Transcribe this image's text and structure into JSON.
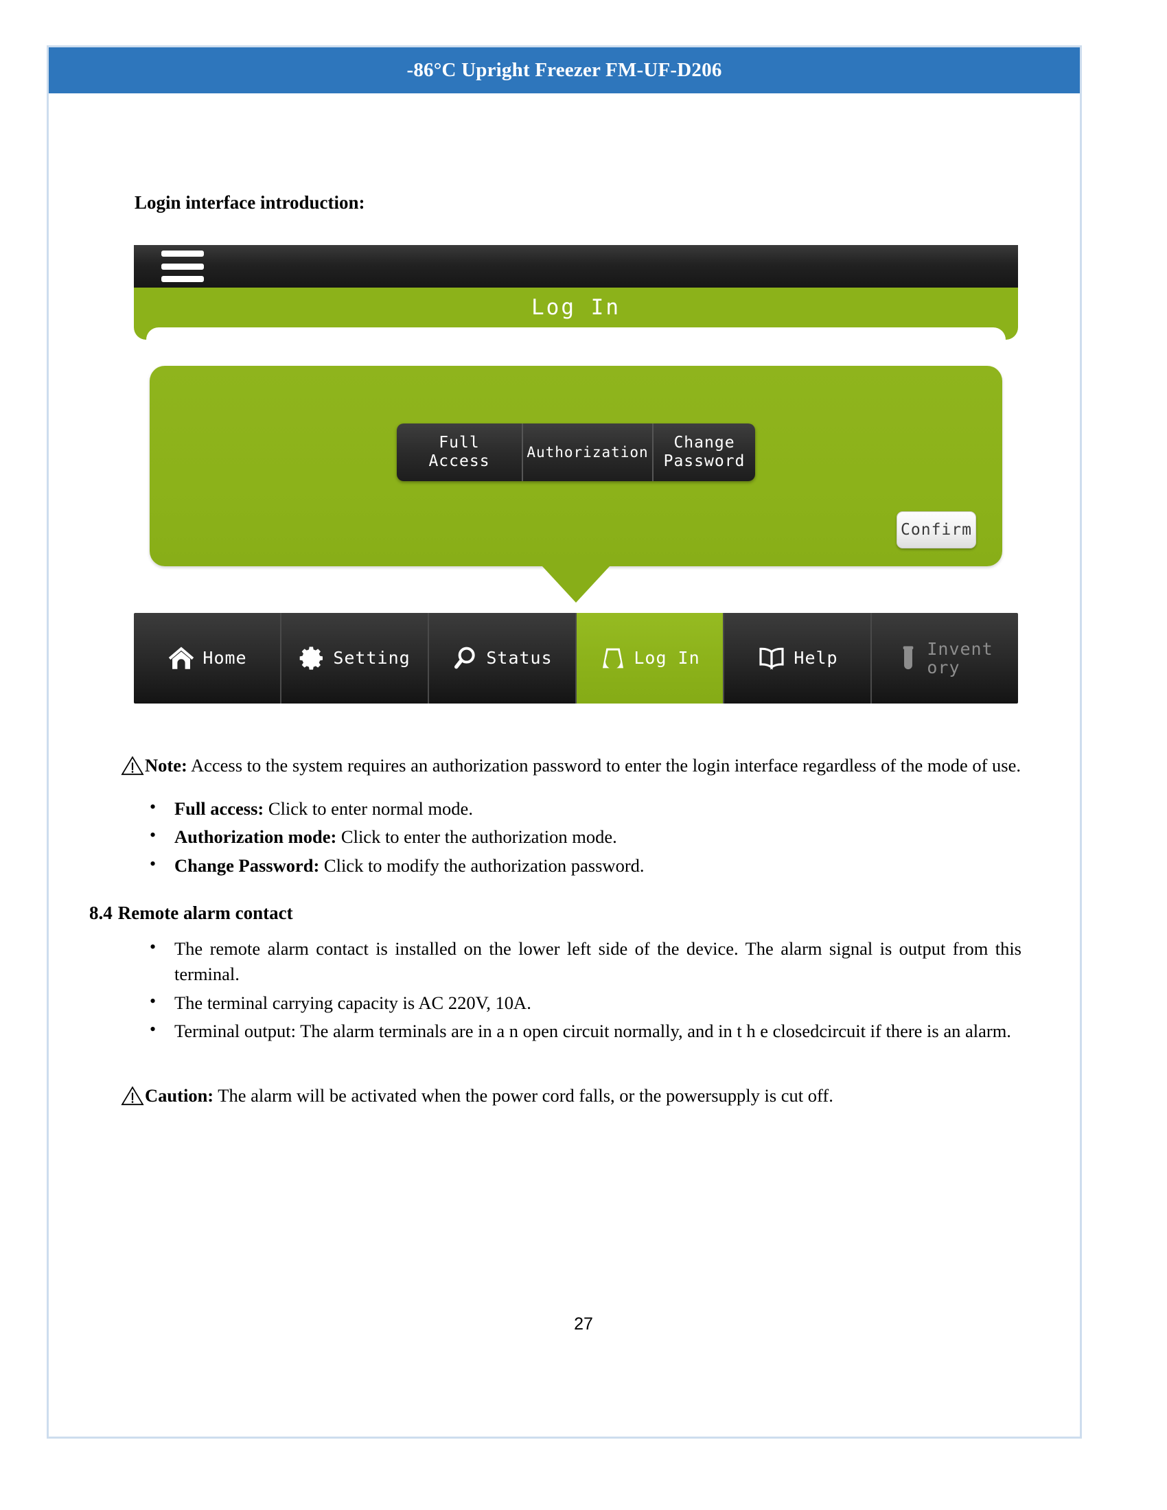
{
  "header": {
    "title": "-86°C Upright Freezer FM-UF-D206"
  },
  "content": {
    "intro_heading": "Login interface introduction:"
  },
  "device": {
    "menu_icon": "hamburger-icon",
    "screen_title": "Log In",
    "mode_buttons": [
      {
        "label": "Full Access",
        "name": "full-access"
      },
      {
        "label": "Authorization",
        "name": "authorization"
      },
      {
        "label": "Change\nPassword",
        "name": "change-password"
      }
    ],
    "confirm_label": "Confirm",
    "nav_items": [
      {
        "label": "Home",
        "icon": "home-icon",
        "active": false,
        "disabled": false
      },
      {
        "label": "Setting",
        "icon": "gear-icon",
        "active": false,
        "disabled": false
      },
      {
        "label": "Status",
        "icon": "magnifier-icon",
        "active": false,
        "disabled": false
      },
      {
        "label": "Log In",
        "icon": "inbox-icon",
        "active": true,
        "disabled": false
      },
      {
        "label": "Help",
        "icon": "book-icon",
        "active": false,
        "disabled": false
      },
      {
        "label": "Invent\nory",
        "icon": "test-tube-icon",
        "active": false,
        "disabled": true
      }
    ]
  },
  "note": {
    "icon": "warning-triangle-icon",
    "label": "Note:",
    "text": " Access to the system requires an authorization password to enter the login interface regardless of the mode of use."
  },
  "mode_list": [
    {
      "label": "Full access:",
      "text": " Click to enter normal mode."
    },
    {
      "label": "Authorization mode:",
      "text": " Click to enter the authorization mode."
    },
    {
      "label": "Change Password:",
      "text": " Click to modify the authorization password."
    }
  ],
  "section_84": {
    "number": "8.4",
    "title": "Remote alarm contact",
    "bullets": [
      "The remote alarm contact is installed on the lower left side of the device. The alarm signal is output from this terminal.",
      "The terminal carrying capacity is AC 220V, 10A.",
      "Terminal output: The alarm terminals are in a n  open circuit normally, and in t h e closedcircuit if there is an alarm."
    ]
  },
  "caution": {
    "icon": "warning-triangle-icon",
    "label": "Caution:",
    "text": " The alarm will be activated when the power cord falls, or the powersupply is cut off."
  },
  "footer": {
    "page_number": "27"
  },
  "colors": {
    "header_blue": "#2e76bc",
    "accent_green": "#8cb21a",
    "panel_dark": "#2a2a2a",
    "border_blue": "#cdddee"
  }
}
